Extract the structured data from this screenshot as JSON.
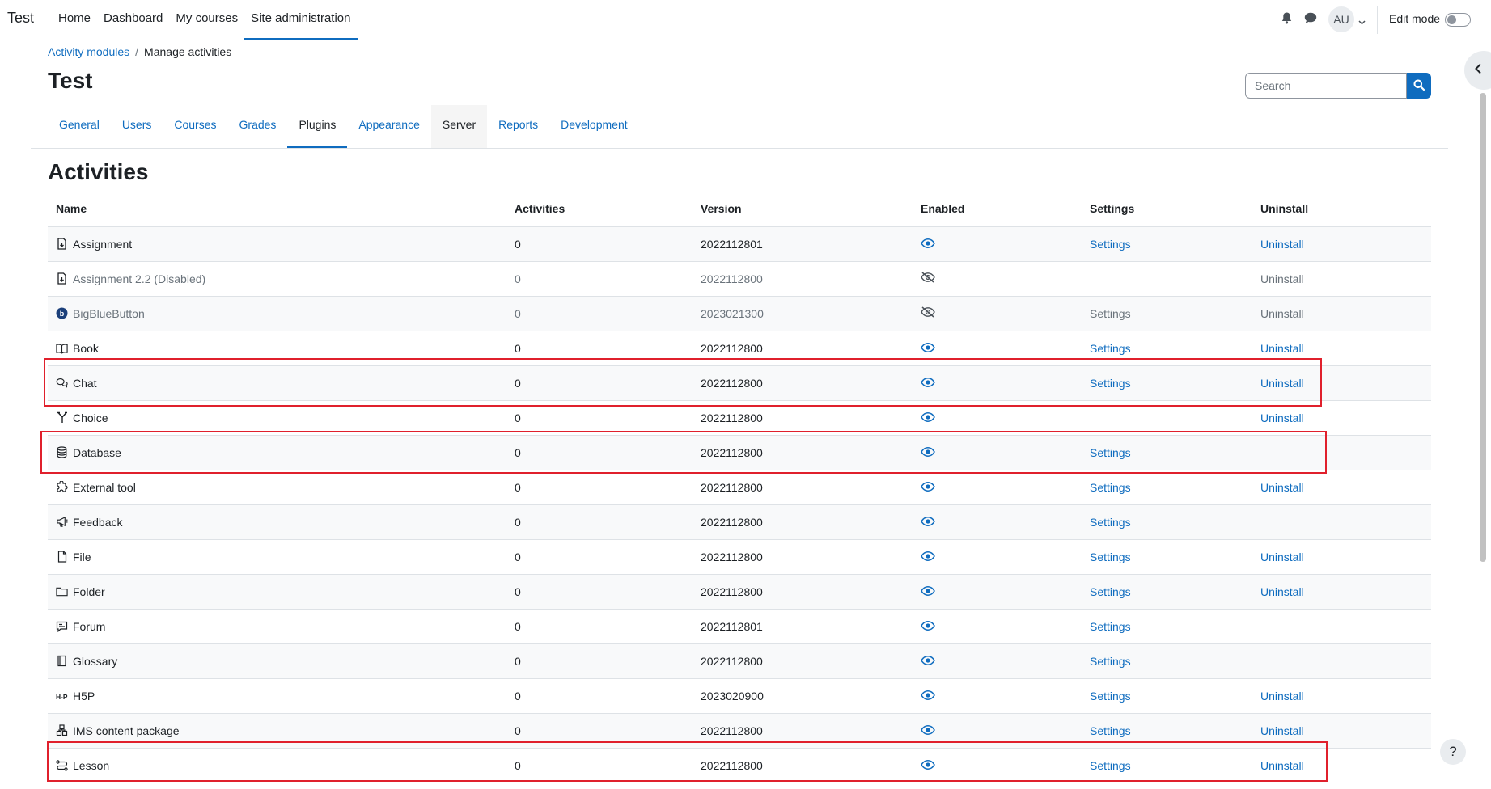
{
  "site": {
    "brand": "Test"
  },
  "primary_nav": [
    "Home",
    "Dashboard",
    "My courses",
    "Site administration"
  ],
  "user": {
    "initials": "AU",
    "edit_mode_label": "Edit mode"
  },
  "breadcrumb": {
    "parent": "Activity modules",
    "separator": "/",
    "current": "Manage activities"
  },
  "page": {
    "title": "Test",
    "section_title": "Activities"
  },
  "search": {
    "placeholder": "Search"
  },
  "tabs": [
    "General",
    "Users",
    "Courses",
    "Grades",
    "Plugins",
    "Appearance",
    "Server",
    "Reports",
    "Development"
  ],
  "table": {
    "headers": [
      "Name",
      "Activities",
      "Version",
      "Enabled",
      "Settings",
      "Uninstall"
    ],
    "rows": [
      {
        "name": "Assignment",
        "icon": "assignment-icon",
        "activities": "0",
        "version": "2022112801",
        "enabled": true,
        "settings": "Settings",
        "settings_link": true,
        "uninstall": "Uninstall",
        "uninstall_link": true
      },
      {
        "name": "Assignment 2.2 (Disabled)",
        "icon": "assignment-icon",
        "activities": "0",
        "version": "2022112800",
        "enabled": false,
        "settings": "",
        "settings_link": false,
        "uninstall": "Uninstall",
        "uninstall_link": false,
        "disabled": true
      },
      {
        "name": "BigBlueButton",
        "icon": "bigbluebutton-icon",
        "activities": "0",
        "version": "2023021300",
        "enabled": false,
        "settings": "Settings",
        "settings_link": false,
        "uninstall": "Uninstall",
        "uninstall_link": false,
        "disabled": true
      },
      {
        "name": "Book",
        "icon": "book-icon",
        "activities": "0",
        "version": "2022112800",
        "enabled": true,
        "settings": "Settings",
        "settings_link": true,
        "uninstall": "Uninstall",
        "uninstall_link": true
      },
      {
        "name": "Chat",
        "icon": "chat-icon",
        "activities": "0",
        "version": "2022112800",
        "enabled": true,
        "settings": "Settings",
        "settings_link": true,
        "uninstall": "Uninstall",
        "uninstall_link": true
      },
      {
        "name": "Choice",
        "icon": "choice-icon",
        "activities": "0",
        "version": "2022112800",
        "enabled": true,
        "settings": "",
        "settings_link": false,
        "uninstall": "Uninstall",
        "uninstall_link": true
      },
      {
        "name": "Database",
        "icon": "database-icon",
        "activities": "0",
        "version": "2022112800",
        "enabled": true,
        "settings": "Settings",
        "settings_link": true,
        "uninstall": "",
        "uninstall_link": false
      },
      {
        "name": "External tool",
        "icon": "external-tool-icon",
        "activities": "0",
        "version": "2022112800",
        "enabled": true,
        "settings": "Settings",
        "settings_link": true,
        "uninstall": "Uninstall",
        "uninstall_link": true
      },
      {
        "name": "Feedback",
        "icon": "feedback-icon",
        "activities": "0",
        "version": "2022112800",
        "enabled": true,
        "settings": "Settings",
        "settings_link": true,
        "uninstall": "",
        "uninstall_link": false
      },
      {
        "name": "File",
        "icon": "file-icon",
        "activities": "0",
        "version": "2022112800",
        "enabled": true,
        "settings": "Settings",
        "settings_link": true,
        "uninstall": "Uninstall",
        "uninstall_link": true
      },
      {
        "name": "Folder",
        "icon": "folder-icon",
        "activities": "0",
        "version": "2022112800",
        "enabled": true,
        "settings": "Settings",
        "settings_link": true,
        "uninstall": "Uninstall",
        "uninstall_link": true
      },
      {
        "name": "Forum",
        "icon": "forum-icon",
        "activities": "0",
        "version": "2022112801",
        "enabled": true,
        "settings": "Settings",
        "settings_link": true,
        "uninstall": "",
        "uninstall_link": false
      },
      {
        "name": "Glossary",
        "icon": "glossary-icon",
        "activities": "0",
        "version": "2022112800",
        "enabled": true,
        "settings": "Settings",
        "settings_link": true,
        "uninstall": "",
        "uninstall_link": false
      },
      {
        "name": "H5P",
        "icon": "h5p-icon",
        "activities": "0",
        "version": "2023020900",
        "enabled": true,
        "settings": "Settings",
        "settings_link": true,
        "uninstall": "Uninstall",
        "uninstall_link": true
      },
      {
        "name": "IMS content package",
        "icon": "ims-package-icon",
        "activities": "0",
        "version": "2022112800",
        "enabled": true,
        "settings": "Settings",
        "settings_link": true,
        "uninstall": "Uninstall",
        "uninstall_link": true
      },
      {
        "name": "Lesson",
        "icon": "lesson-icon",
        "activities": "0",
        "version": "2022112800",
        "enabled": true,
        "settings": "Settings",
        "settings_link": true,
        "uninstall": "Uninstall",
        "uninstall_link": true
      }
    ]
  },
  "help": {
    "label": "?"
  },
  "colors": {
    "link": "#0f6cbf",
    "highlight": "#e0202c",
    "muted": "#6a737b"
  }
}
